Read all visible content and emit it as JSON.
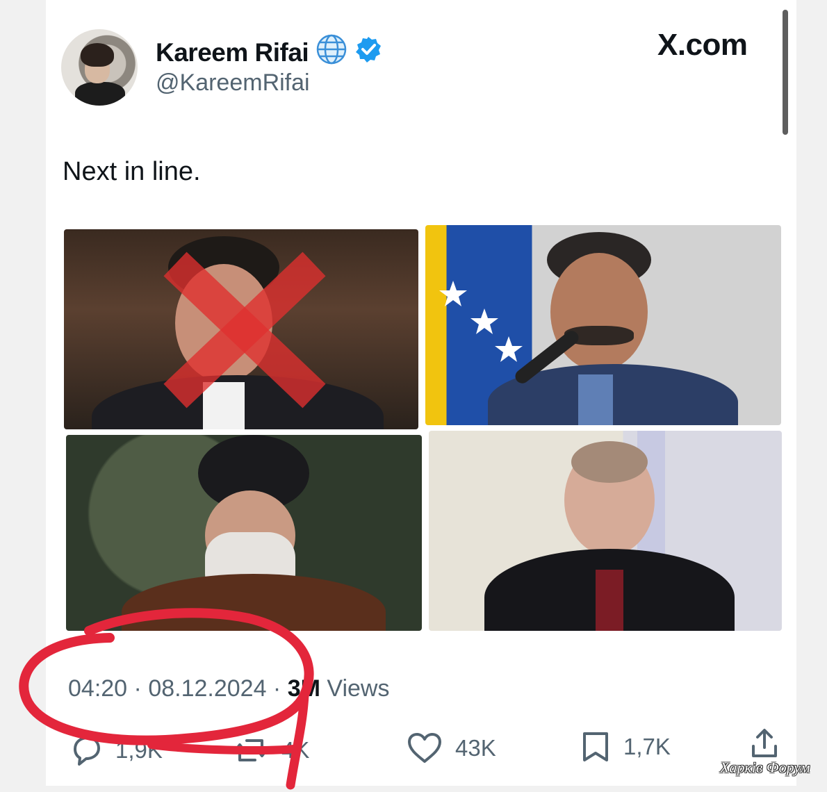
{
  "header": {
    "display_name": "Kareem Rifai",
    "handle": "@KareemRifai",
    "site_label": "X.com",
    "globe_icon": "globe-icon",
    "verified_icon": "verified-badge-icon",
    "verified_color": "#1d9bf0"
  },
  "tweet": {
    "text": "Next in line.",
    "time": "04:20",
    "separator": " · ",
    "date": "08.12.2024",
    "views_count": "3M",
    "views_label": " Views",
    "images": [
      {
        "id": "photo-1",
        "crossed_out": true
      },
      {
        "id": "photo-2",
        "crossed_out": false
      },
      {
        "id": "photo-3",
        "crossed_out": false
      },
      {
        "id": "photo-4",
        "crossed_out": false
      }
    ]
  },
  "actions": {
    "reply_count": "1,9K",
    "retweet_count": "4K",
    "like_count": "43K",
    "bookmark_count": "1,7K"
  },
  "annotation": {
    "color": "#e3263b"
  },
  "watermark": "Харків Форум"
}
